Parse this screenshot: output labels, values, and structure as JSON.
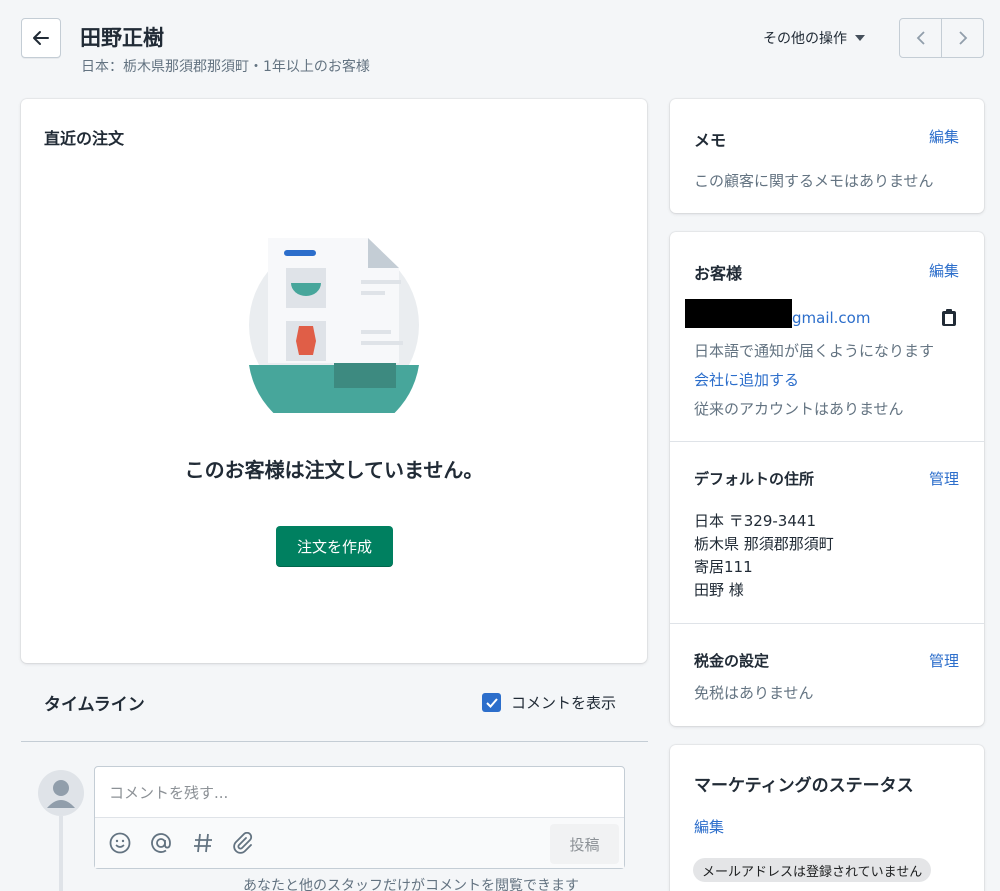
{
  "header": {
    "title": "田野正樹",
    "subtitle": "日本：栃木県那須郡那須町・1年以上のお客様",
    "more_actions_label": "その他の操作"
  },
  "orders": {
    "title": "直近の注文",
    "empty_message": "このお客様は注文していません。",
    "create_order_label": "注文を作成"
  },
  "timeline": {
    "title": "タイムライン",
    "show_comments_label": "コメントを表示",
    "show_comments_checked": true,
    "comment_placeholder": "コメントを残す...",
    "post_label": "投稿",
    "note": "あなたと他のスタッフだけがコメントを閲覧できます"
  },
  "memo": {
    "title": "メモ",
    "edit_label": "編集",
    "empty_text": "この顧客に関するメモはありません"
  },
  "customer": {
    "title": "お客様",
    "edit_label": "編集",
    "email_visible": "gmail.com",
    "language_note": "日本語で通知が届くようになります",
    "add_company_label": "会社に追加する",
    "legacy_account_note": "従来のアカウントはありません",
    "default_address_title": "デフォルトの住所",
    "manage_label": "管理",
    "address_lines": [
      "日本 〒329-3441",
      "栃木県 那須郡那須町",
      "寄居111",
      "田野 様"
    ],
    "tax_title": "税金の設定",
    "tax_manage_label": "管理",
    "tax_note": "免税はありません"
  },
  "marketing": {
    "title": "マーケティングのステータス",
    "edit_label": "編集",
    "status_badge": "メールアドレスは登録されていません"
  },
  "colors": {
    "primary": "#008060",
    "link": "#2c6ecb",
    "background": "#f4f6f8"
  },
  "icons": [
    "arrow-left-icon",
    "caret-down-icon",
    "chevron-left-icon",
    "chevron-right-icon",
    "clipboard-icon",
    "checkmark-icon",
    "avatar-icon",
    "emoji-icon",
    "mention-icon",
    "hashtag-icon",
    "attachment-icon"
  ]
}
